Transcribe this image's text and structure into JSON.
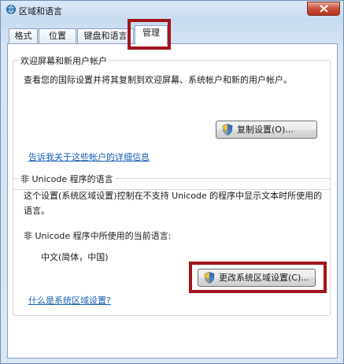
{
  "window": {
    "title": "区域和语言",
    "close_icon": "close-icon"
  },
  "tabs": [
    {
      "label": "格式",
      "active": false
    },
    {
      "label": "位置",
      "active": false
    },
    {
      "label": "键盘和语言",
      "active": false
    },
    {
      "label": "管理",
      "active": true
    }
  ],
  "welcome_group": {
    "title": "欢迎屏幕和新用户帐户",
    "description": "查看您的国际设置并将其复制到欢迎屏幕、系统帐户和新的用户帐户。",
    "copy_button": "复制设置(O)...",
    "link": "告诉我关于这些帐户的详细信息"
  },
  "unicode_group": {
    "title": "非 Unicode 程序的语言",
    "description": "这个设置(系统区域设置)控制在不支持 Unicode 的程序中显示文本时所使用的语言。",
    "current_label": "非 Unicode 程序中所使用的当前语言:",
    "current_value": "中文(简体，中国)",
    "change_button": "更改系统区域设置(C)...",
    "link": "什么是系统区域设置?"
  },
  "colors": {
    "highlight": "#a3141c",
    "link": "#1a5fb4",
    "panel_border": "#8da2bd"
  }
}
